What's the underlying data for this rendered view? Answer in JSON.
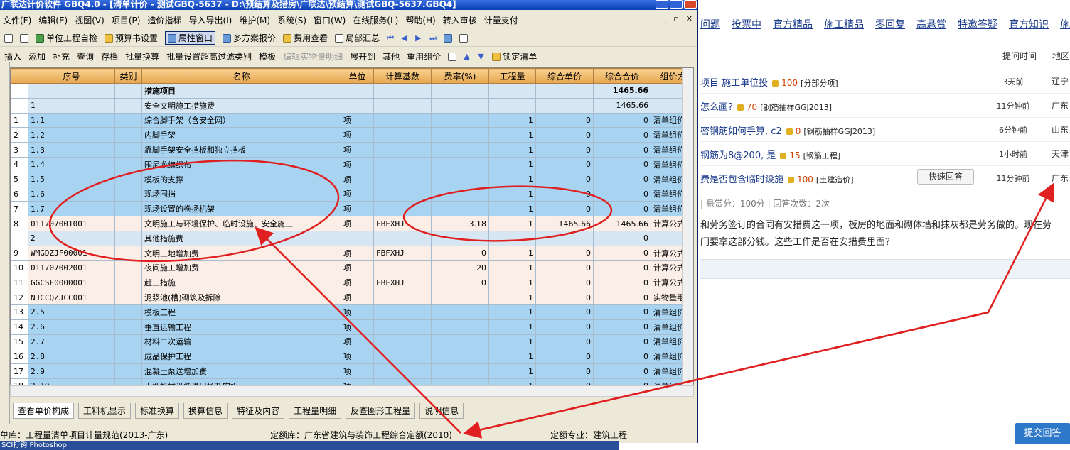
{
  "window": {
    "title": "广联达计价软件 GBQ4.0 - [清单计价 - 测试GBQ-5637 - D:\\预结算及猎房\\广联达\\预结算\\测试GBQ-5637.GBQ4]"
  },
  "menu": [
    "文件(F)",
    "编辑(E)",
    "视图(V)",
    "项目(P)",
    "造价指标",
    "导入导出(I)",
    "维护(M)",
    "系统(S)",
    "窗口(W)",
    "在线服务(L)",
    "帮助(H)",
    "转入审核",
    "计量支付"
  ],
  "toolbar1": {
    "unit_check": "单位工程自检",
    "budget_settings": "预算书设置",
    "property_window": "属性窗口",
    "multi_quote": "多方案报价",
    "fee_view": "费用查看",
    "partial_summary": "局部汇总"
  },
  "toolbar2": [
    "插入",
    "添加",
    "补充",
    "查询",
    "存档",
    "批量换算",
    "批量设置超高过滤类别",
    "模板",
    "编辑实物量明细",
    "展开到",
    "其他",
    "重用组价",
    "锁定清单"
  ],
  "grid": {
    "headers": [
      "序号",
      "类别",
      "名称",
      "单位",
      "计算基数",
      "费率(%)",
      "工程量",
      "综合单价",
      "综合合价",
      "组价方"
    ],
    "rows": [
      {
        "idx": "",
        "seq": "",
        "name": "措施项目",
        "unit": "",
        "base": "",
        "rate": "",
        "qty": "",
        "price": "",
        "total": "1465.66",
        "method": "",
        "style": "head"
      },
      {
        "idx": "",
        "seq": "1",
        "name": "安全文明施工措施费",
        "unit": "",
        "base": "",
        "rate": "",
        "qty": "",
        "price": "",
        "total": "1465.66",
        "method": "",
        "style": "head"
      },
      {
        "idx": "1",
        "seq": "1.1",
        "name": "综合脚手架（含安全网）",
        "unit": "项",
        "base": "",
        "rate": "",
        "qty": "1",
        "price": "0",
        "total": "0",
        "method": "清单组价",
        "style": "blue"
      },
      {
        "idx": "2",
        "seq": "1.2",
        "name": "内脚手架",
        "unit": "项",
        "base": "",
        "rate": "",
        "qty": "1",
        "price": "0",
        "total": "0",
        "method": "清单组价",
        "style": "blue"
      },
      {
        "idx": "3",
        "seq": "1.3",
        "name": "靠脚手架安全挡板和独立挡板",
        "unit": "项",
        "base": "",
        "rate": "",
        "qty": "1",
        "price": "0",
        "total": "0",
        "method": "清单组价",
        "style": "blue"
      },
      {
        "idx": "4",
        "seq": "1.4",
        "name": "围尼龙编织布",
        "unit": "项",
        "base": "",
        "rate": "",
        "qty": "1",
        "price": "0",
        "total": "0",
        "method": "清单组价",
        "style": "blue"
      },
      {
        "idx": "5",
        "seq": "1.5",
        "name": "模板的支撑",
        "unit": "项",
        "base": "",
        "rate": "",
        "qty": "1",
        "price": "0",
        "total": "0",
        "method": "清单组价",
        "style": "blue"
      },
      {
        "idx": "6",
        "seq": "1.6",
        "name": "现场围挡",
        "unit": "项",
        "base": "",
        "rate": "",
        "qty": "1",
        "price": "0",
        "total": "0",
        "method": "清单组价",
        "style": "blue"
      },
      {
        "idx": "7",
        "seq": "1.7",
        "name": "现场设置的卷扬机架",
        "unit": "项",
        "base": "",
        "rate": "",
        "qty": "1",
        "price": "0",
        "total": "0",
        "method": "清单组价",
        "style": "blue"
      },
      {
        "idx": "8",
        "seq": "011707001001",
        "name": "文明施工与环境保护、临时设施、安全施工",
        "unit": "项",
        "base": "FBFXHJ",
        "rate": "3.18",
        "qty": "1",
        "price": "1465.66",
        "total": "1465.66",
        "method": "计算公式",
        "style": "pink"
      },
      {
        "idx": "",
        "seq": "2",
        "name": "其他措施费",
        "unit": "",
        "base": "",
        "rate": "",
        "qty": "",
        "price": "",
        "total": "0",
        "method": "",
        "style": "head"
      },
      {
        "idx": "9",
        "seq": "WMGDZJF00001",
        "name": "文明工地增加费",
        "unit": "项",
        "base": "FBFXHJ",
        "rate": "0",
        "qty": "1",
        "price": "0",
        "total": "0",
        "method": "计算公式",
        "style": "pink"
      },
      {
        "idx": "10",
        "seq": "011707002001",
        "name": "夜间施工增加费",
        "unit": "项",
        "base": "",
        "rate": "20",
        "qty": "1",
        "price": "0",
        "total": "0",
        "method": "计算公式",
        "style": "pink"
      },
      {
        "idx": "11",
        "seq": "GGCSF0000001",
        "name": "赶工措施",
        "unit": "项",
        "base": "FBFXHJ",
        "rate": "0",
        "qty": "1",
        "price": "0",
        "total": "0",
        "method": "计算公式",
        "style": "pink"
      },
      {
        "idx": "12",
        "seq": "NJCCQZJCC001",
        "name": "泥浆池(槽)砌筑及拆除",
        "unit": "项",
        "base": "",
        "rate": "",
        "qty": "1",
        "price": "0",
        "total": "0",
        "method": "实物量组",
        "style": "pink"
      },
      {
        "idx": "13",
        "seq": "2.5",
        "name": "模板工程",
        "unit": "项",
        "base": "",
        "rate": "",
        "qty": "1",
        "price": "0",
        "total": "0",
        "method": "清单组价",
        "style": "blue"
      },
      {
        "idx": "14",
        "seq": "2.6",
        "name": "垂直运输工程",
        "unit": "项",
        "base": "",
        "rate": "",
        "qty": "1",
        "price": "0",
        "total": "0",
        "method": "清单组价",
        "style": "blue"
      },
      {
        "idx": "15",
        "seq": "2.7",
        "name": "材料二次运输",
        "unit": "项",
        "base": "",
        "rate": "",
        "qty": "1",
        "price": "0",
        "total": "0",
        "method": "清单组价",
        "style": "blue"
      },
      {
        "idx": "16",
        "seq": "2.8",
        "name": "成品保护工程",
        "unit": "项",
        "base": "",
        "rate": "",
        "qty": "1",
        "price": "0",
        "total": "0",
        "method": "清单组价",
        "style": "blue"
      },
      {
        "idx": "17",
        "seq": "2.9",
        "name": "混凝土泵送增加费",
        "unit": "项",
        "base": "",
        "rate": "",
        "qty": "1",
        "price": "0",
        "total": "0",
        "method": "清单组价",
        "style": "blue"
      },
      {
        "idx": "18",
        "seq": "2.10",
        "name": "大型机械设备进出场及安拆",
        "unit": "项",
        "base": "",
        "rate": "",
        "qty": "1",
        "price": "0",
        "total": "0",
        "method": "清单组价",
        "style": "blue"
      }
    ]
  },
  "tabs": [
    "查看单价构成",
    "工料机显示",
    "标准换算",
    "换算信息",
    "特征及内容",
    "工程量明细",
    "反查图形工程量",
    "说明信息"
  ],
  "status": {
    "bill_lib": "单库：工程量清单项目计量规范(2013-广东)",
    "quota_lib": "定额库：广东省建筑与装饰工程综合定额(2010)",
    "quota_major": "定额专业：建筑工程"
  },
  "taskbar": "SCI打钩  Photoshop",
  "web": {
    "nav": [
      "问题",
      "投票中",
      "官方精品",
      "施工精品",
      "零回复",
      "高悬赏",
      "特邀答疑",
      "官方知识",
      "施"
    ],
    "col_time": "提问时间",
    "col_region": "地区",
    "questions": [
      {
        "title": "项目 施工单位投",
        "points": "100",
        "cat": "[分部分项]",
        "time": "3天前",
        "region": "辽宁"
      },
      {
        "title": "怎么画?",
        "points": "70",
        "cat": "[钢筋抽样GGJ2013]",
        "time": "11分钟前",
        "region": "广东"
      },
      {
        "title": "密钢筋如何手算, c2",
        "points": "0",
        "cat": "[钢筋抽样GGJ2013]",
        "time": "6分钟前",
        "region": "山东"
      },
      {
        "title": "钢筋为8@200, 是",
        "points": "15",
        "cat": "[钢筋工程]",
        "time": "1小时前",
        "region": "天津"
      },
      {
        "title": "费是否包含临时设施",
        "points": "100",
        "cat": "[土建造价]",
        "time": "11分钟前",
        "region": "广东"
      }
    ],
    "quick_reply": "快速回答",
    "meta": "|    悬赏分：100分    |    回答次数：2次",
    "body_line1": "和劳务签订的合同有安措费这一项，板房的地面和砌体墙和抹灰都是劳务做的。现在劳",
    "body_line2": "门要拿这部分钱。这些工作是否在安措费里面？",
    "submit": "提交回答"
  },
  "colors": {
    "blue_row": "#a8d4f2",
    "pink_row": "#fbeee6",
    "annotation": "#e02020",
    "titlebar": "#0a3fb4"
  }
}
